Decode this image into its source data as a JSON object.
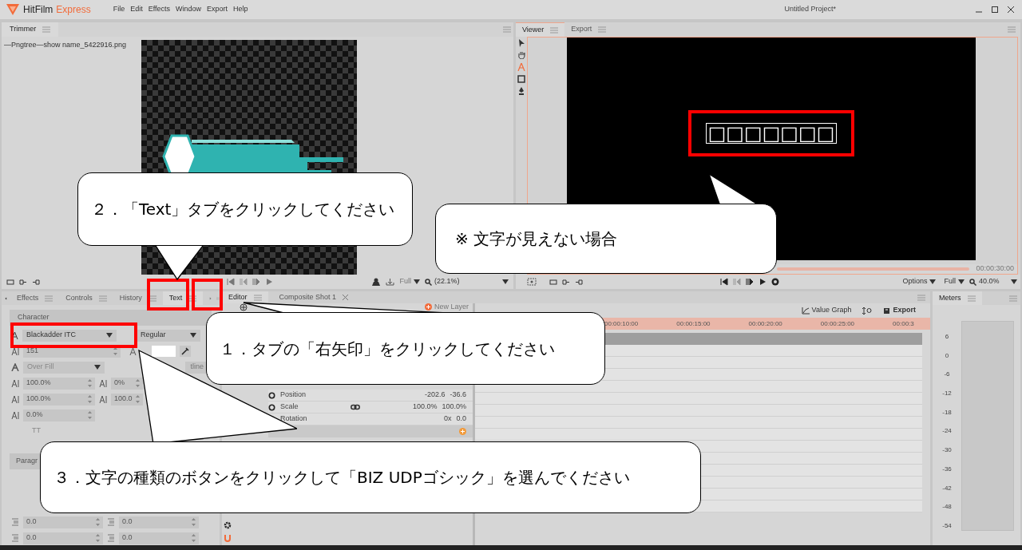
{
  "app": {
    "title": "HitFilm",
    "edition": "Express",
    "menu": [
      "File",
      "Edit",
      "Effects",
      "Window",
      "Export",
      "Help"
    ],
    "project": "Untitled Project*"
  },
  "trimmer": {
    "tabs": [
      {
        "label": "Trimmer",
        "selected": true
      }
    ],
    "file_name": "—Pngtree—show name_5422916.png",
    "quality": "Full",
    "zoom": "(22.1%)"
  },
  "viewer": {
    "tabs": [
      {
        "label": "Viewer",
        "selected": true
      },
      {
        "label": "Export",
        "selected": false
      }
    ],
    "tools": [
      {
        "kind": "select",
        "selected": false
      },
      {
        "kind": "hand",
        "selected": false
      },
      {
        "kind": "text",
        "selected": true
      },
      {
        "kind": "mask",
        "selected": false
      },
      {
        "kind": "pen",
        "selected": false
      }
    ],
    "preview_text": "□□□□□□□",
    "timecode": "00:00:30:00",
    "options": "Options",
    "quality": "Full",
    "zoom": "40.0%"
  },
  "text_panel": {
    "tabs": [
      {
        "label": "Effects",
        "selected": false
      },
      {
        "label": "Controls",
        "selected": false
      },
      {
        "label": "History",
        "selected": false
      },
      {
        "label": "Text",
        "selected": true
      }
    ],
    "character_heading": "Character",
    "font": "Blackadder ITC",
    "style": "Regular",
    "size": "151",
    "fill_mode": "Over Fill",
    "outline_button": "tline",
    "metrics": [
      {
        "value": "100.0%"
      },
      {
        "value": "0%"
      },
      {
        "value": "100.0%"
      },
      {
        "value": "100.0"
      },
      {
        "value": "0.0%"
      }
    ],
    "caps_button": "TT",
    "paragraph_heading": "Paragr",
    "paragraph_fields": [
      {
        "value": "0.0"
      },
      {
        "value": "0.0"
      },
      {
        "value": "0.0"
      },
      {
        "value": "0.0"
      }
    ]
  },
  "editor": {
    "tabs": [
      {
        "label": "Editor",
        "selected": true,
        "closable": false
      },
      {
        "label": "Composite Shot 1",
        "selected": false,
        "closable": true
      }
    ],
    "new_layer": "New Layer",
    "value_graph": "Value Graph",
    "export": "Export",
    "ruler": [
      "00:00:10:00",
      "00:00:15:00",
      "00:00:20:00",
      "00:00:25:00",
      "00:00:3"
    ],
    "properties": [
      {
        "name": "Position",
        "linked": false,
        "values": [
          "-202.6",
          "-36.6"
        ]
      },
      {
        "name": "Scale",
        "linked": true,
        "values": [
          "100.0%",
          "100.0%"
        ]
      },
      {
        "name": "Rotation",
        "linked": false,
        "values": [
          "0x",
          "0.0"
        ]
      }
    ]
  },
  "meters": {
    "tabs": [
      {
        "label": "Meters",
        "selected": true
      }
    ],
    "scale": [
      "6",
      "0",
      "-6",
      "-12",
      "-18",
      "-24",
      "-30",
      "-36",
      "-42",
      "-48",
      "-54"
    ]
  },
  "callouts": [
    {
      "text": "２．「Text」タブをクリックしてください"
    },
    {
      "text": "※ 文字が見えない場合"
    },
    {
      "text": "１．タブの「右矢印」をクリックしてください"
    },
    {
      "text": "３．文字の種類のボタンをクリックして「BIZ UDPゴシック」を選んでください"
    }
  ]
}
